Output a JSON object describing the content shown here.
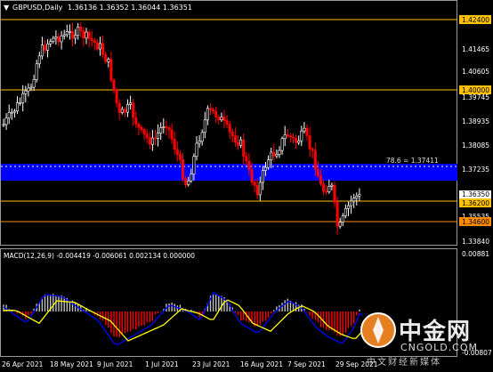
{
  "header": {
    "symbol_label": "GBPUSD,Daily",
    "ohlc_label": "1.36136 1.36352 1.36044 1.36351"
  },
  "macd_panel": {
    "header_label": "MACD(12,26,9) -0.004419 -0.006061 0.002134 0.000000",
    "scale_top": "0.00881",
    "scale_bottom": "-0.00807"
  },
  "price_scale": {
    "labels": [
      "1.42400",
      "1.41465",
      "1.40605",
      "1.40000",
      "1.39745",
      "1.38935",
      "1.38085",
      "1.37235",
      "1.36350",
      "1.36200",
      "1.35535",
      "1.34600",
      "1.33840"
    ]
  },
  "levels": {
    "l1": "1.42400",
    "l2": "1.40000",
    "l3": "1.36200",
    "l4": "1.34600",
    "fib_label": "78.6 = 1.37411"
  },
  "time_axis": {
    "labels": [
      "26 Apr 2021",
      "18 May 2021",
      "9 Jun 2021",
      "1 Jul 2021",
      "23 Jul 2021",
      "16 Aug 2021",
      "7 Sep 2021",
      "29 Sep 2021"
    ]
  },
  "watermark": {
    "name": "中金网",
    "domain": "CNGOLD.COM",
    "slogan": "中文财经新媒体"
  },
  "colors": {
    "background": "#000000",
    "bull_candle": "#ffffff",
    "bear_candle": "#ff0000",
    "level_line": "#ffc000",
    "support_line": "#ff8c00",
    "fib_zone": "#0000ff",
    "macd_positive": "#c0c0c0",
    "macd_negative": "#ff0000",
    "macd_signal": "#ffff00",
    "macd_main": "#0000ff"
  }
}
